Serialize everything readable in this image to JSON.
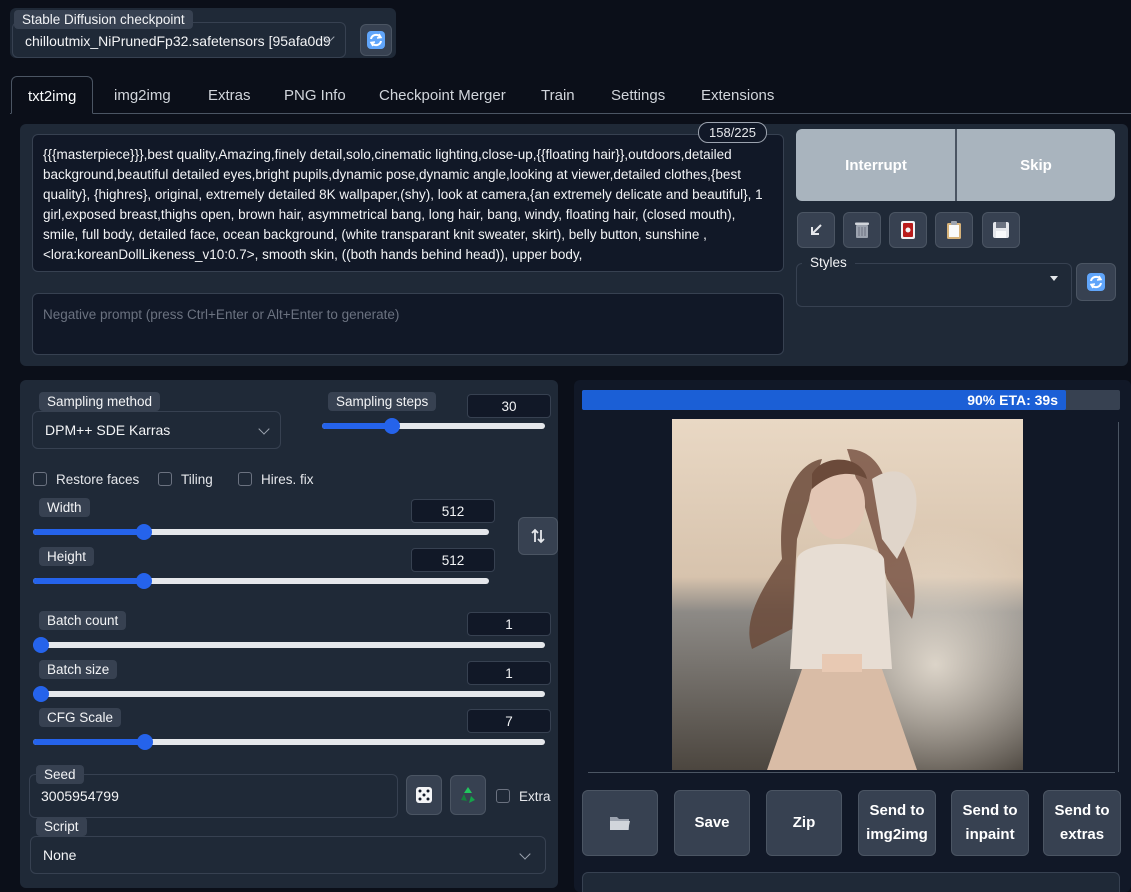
{
  "checkpoint": {
    "label": "Stable Diffusion checkpoint",
    "value": "chilloutmix_NiPrunedFp32.safetensors [95afa0d9"
  },
  "tabs": [
    "txt2img",
    "img2img",
    "Extras",
    "PNG Info",
    "Checkpoint Merger",
    "Train",
    "Settings",
    "Extensions"
  ],
  "prompt": {
    "token_count": "158/225",
    "text": "{{{masterpiece}}},best quality,Amazing,finely detail,solo,cinematic lighting,close-up,{{floating hair}},outdoors,detailed background,beautiful detailed eyes,bright pupils,dynamic pose,dynamic angle,looking at viewer,detailed clothes,{best quality}, {highres}, original, extremely detailed 8K wallpaper,(shy), look at camera,{an extremely delicate and beautiful}, 1 girl,exposed breast,thighs open, brown hair, asymmetrical bang, long hair, bang, windy, floating hair, (closed mouth), smile, full body, detailed face, ocean background, (white transparant knit sweater, skirt), belly button, sunshine , <lora:koreanDollLikeness_v10:0.7>, smooth skin, ((both hands behind head)), upper body,",
    "negative_placeholder": "Negative prompt (press Ctrl+Enter or Alt+Enter to generate)"
  },
  "actions": {
    "interrupt": "Interrupt",
    "skip": "Skip",
    "styles_label": "Styles"
  },
  "settings": {
    "sampling_method_label": "Sampling method",
    "sampling_method_value": "DPM++ SDE Karras",
    "sampling_steps_label": "Sampling steps",
    "sampling_steps_value": "30",
    "sampling_steps_level": 0.3,
    "restore_faces": "Restore faces",
    "tiling": "Tiling",
    "hires_fix": "Hires. fix",
    "width_label": "Width",
    "width_value": "512",
    "width_level": 0.235,
    "height_label": "Height",
    "height_value": "512",
    "height_level": 0.235,
    "batch_count_label": "Batch count",
    "batch_count_value": "1",
    "batch_count_level": 0.0,
    "batch_size_label": "Batch size",
    "batch_size_value": "1",
    "batch_size_level": 0.0,
    "cfg_label": "CFG Scale",
    "cfg_value": "7",
    "cfg_level": 0.21,
    "seed_label": "Seed",
    "seed_value": "3005954799",
    "extra_label": "Extra",
    "script_label": "Script",
    "script_value": "None"
  },
  "output": {
    "progress_text": "90% ETA: 39s",
    "progress_fraction": 0.9,
    "buttons": {
      "save": "Save",
      "zip": "Zip",
      "send_img2img_1": "Send to",
      "send_img2img_2": "img2img",
      "send_inpaint_1": "Send to",
      "send_inpaint_2": "inpaint",
      "send_extras_1": "Send to",
      "send_extras_2": "extras"
    }
  },
  "colors": {
    "background": "#0b0f19",
    "panel": "#1f2937",
    "accent": "#2563eb",
    "progress": "#1b5fd6"
  }
}
